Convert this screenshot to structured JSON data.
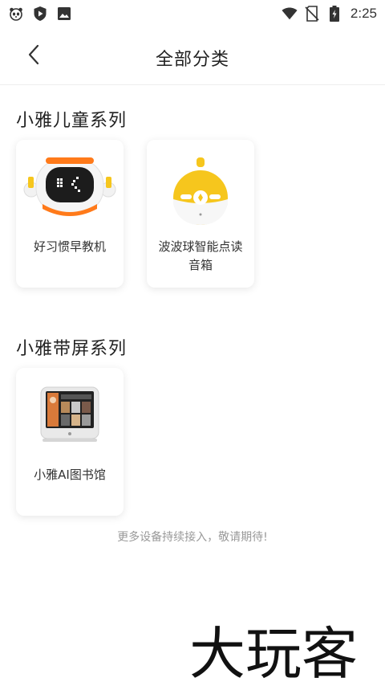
{
  "status_bar": {
    "time": "2:25",
    "left_icons": [
      "panda-app-icon",
      "play-shield-icon",
      "image-icon"
    ],
    "right_icons": [
      "wifi-icon",
      "no-sim-icon",
      "battery-charging-icon"
    ]
  },
  "header": {
    "title": "全部分类",
    "back_icon": "chevron-left-icon"
  },
  "sections": [
    {
      "title": "小雅儿童系列",
      "items": [
        {
          "label": "好习惯早教机",
          "image": "robot-learning-device"
        },
        {
          "label": "波波球智能点读音箱",
          "image": "yellow-ball-speaker"
        }
      ]
    },
    {
      "title": "小雅带屏系列",
      "items": [
        {
          "label": "小雅AI图书馆",
          "image": "screen-device"
        }
      ]
    }
  ],
  "footer_note": "更多设备持续接入，敬请期待!",
  "watermark": "大玩客",
  "colors": {
    "accent_orange": "#ff7a1a",
    "accent_yellow": "#f6c61d",
    "title_text": "#222222",
    "muted_text": "#999999"
  }
}
